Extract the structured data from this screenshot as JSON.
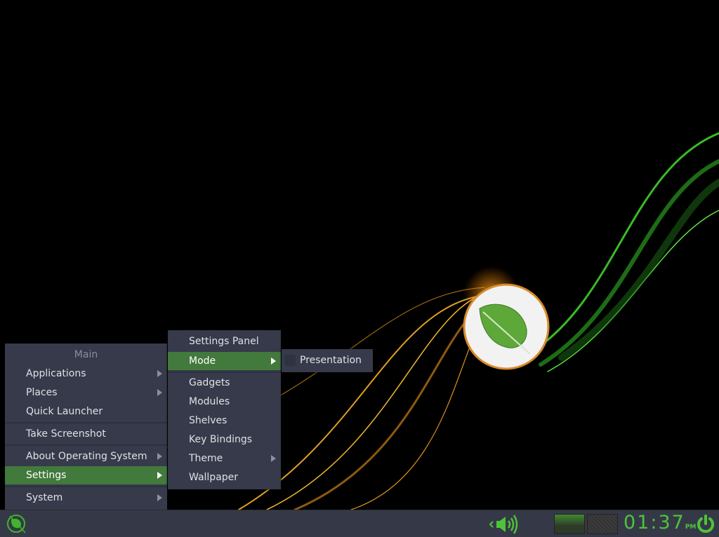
{
  "main_menu": {
    "header": "Main",
    "items": [
      {
        "label": "Applications",
        "submenu": true
      },
      {
        "label": "Places",
        "submenu": true
      },
      {
        "label": "Quick Launcher",
        "submenu": false
      },
      {
        "label": "Take Screenshot",
        "submenu": false
      },
      {
        "label": "About Operating System",
        "submenu": true
      },
      {
        "label": "Settings",
        "submenu": true,
        "highlighted": true
      },
      {
        "label": "System",
        "submenu": true
      }
    ]
  },
  "settings_menu": {
    "items": [
      {
        "label": "Settings Panel"
      },
      {
        "label": "Mode",
        "highlighted": true
      },
      {
        "label": "Gadgets"
      },
      {
        "label": "Modules"
      },
      {
        "label": "Shelves"
      },
      {
        "label": "Key Bindings"
      },
      {
        "label": "Theme",
        "submenu": true
      },
      {
        "label": "Wallpaper"
      }
    ]
  },
  "mode_menu": {
    "items": [
      {
        "label": "Presentation",
        "checked": false
      }
    ]
  },
  "taskbar": {
    "clock": "01:37",
    "ampm": "PM",
    "start_icon": "leaf-icon",
    "volume_icon": "speaker-icon",
    "power_icon": "power-icon"
  },
  "colors": {
    "accent": "#42793c",
    "menu_bg": "#363a4a",
    "clock": "#4fc23a"
  }
}
